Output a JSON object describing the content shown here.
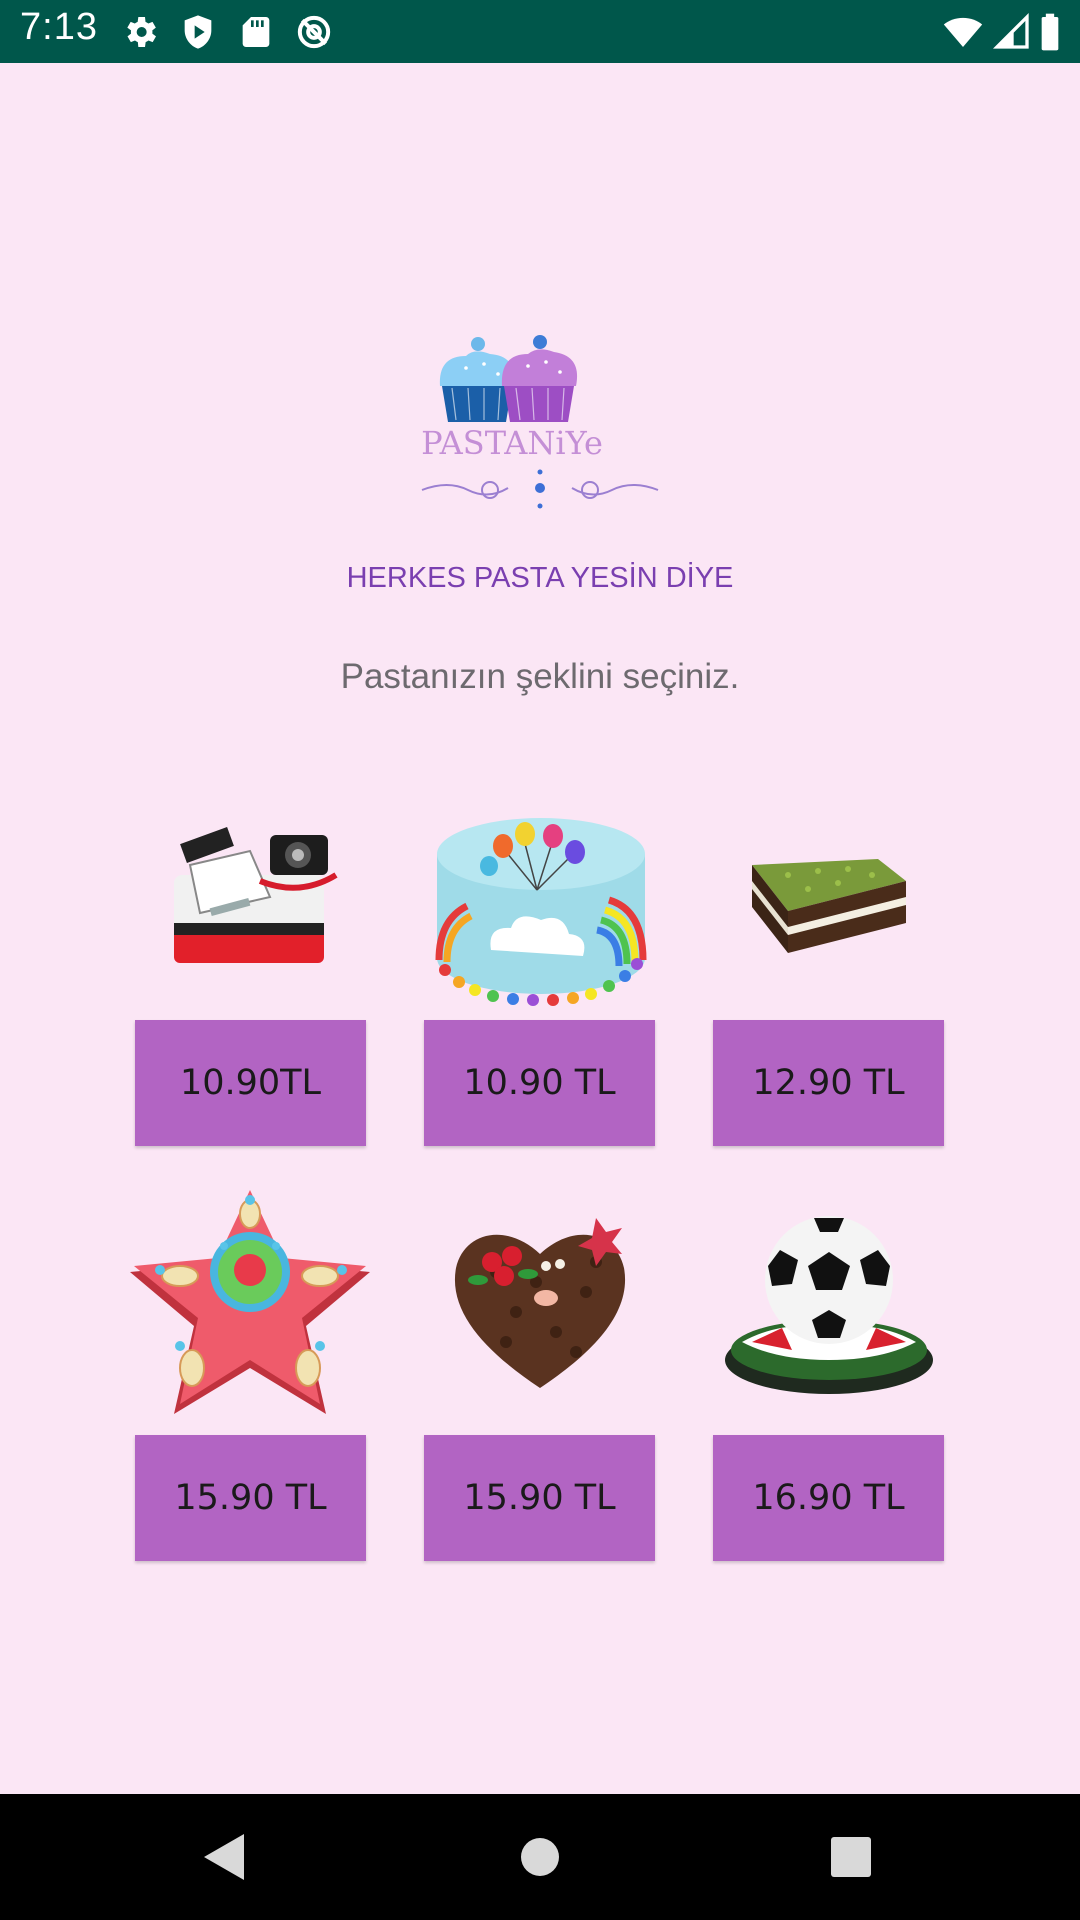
{
  "status_bar": {
    "time": "7:13",
    "left_icons": [
      "gear-icon",
      "play-shield-icon",
      "sd-card-icon",
      "no-sync-icon"
    ],
    "right_icons": [
      "wifi-icon",
      "cell-signal-icon",
      "battery-icon"
    ],
    "color": "#00574b"
  },
  "header": {
    "logo_text": "PASTANiYe",
    "slogan": "HERKES PASTA YESİN DİYE",
    "prompt": "Pastanızın şeklini seçiniz."
  },
  "products": [
    {
      "name": "camera-cake-image",
      "price": "10.90TL"
    },
    {
      "name": "rainbow-cake-image",
      "price": "10.90 TL"
    },
    {
      "name": "pistachio-slice-image",
      "price": "12.90 TL"
    },
    {
      "name": "star-cake-image",
      "price": "15.90 TL"
    },
    {
      "name": "heart-cake-image",
      "price": "15.90 TL"
    },
    {
      "name": "football-cake-image",
      "price": "16.90 TL"
    }
  ],
  "navigation": {
    "buttons": [
      "back-icon",
      "home-icon",
      "recents-icon"
    ]
  },
  "colors": {
    "background": "#fbe6f5",
    "button": "#b264c3",
    "slogan": "#7a3fb0",
    "prompt": "#6d6a6f"
  }
}
